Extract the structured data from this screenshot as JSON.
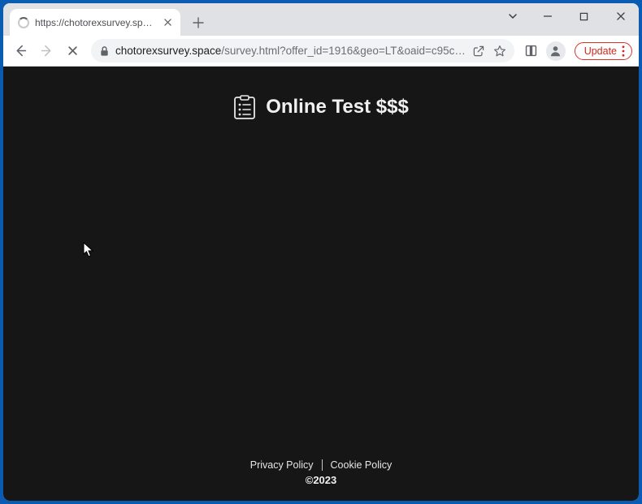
{
  "tab": {
    "title": "https://chotorexsurvey.space/sur"
  },
  "url": {
    "host": "chotorexsurvey.space",
    "path": "/survey.html?offer_id=1916&geo=LT&oaid=c95c…"
  },
  "toolbar": {
    "update_label": "Update"
  },
  "page": {
    "title": "Online Test $$$"
  },
  "footer": {
    "privacy": "Privacy Policy",
    "cookie": "Cookie Policy",
    "copyright": "©2023"
  }
}
